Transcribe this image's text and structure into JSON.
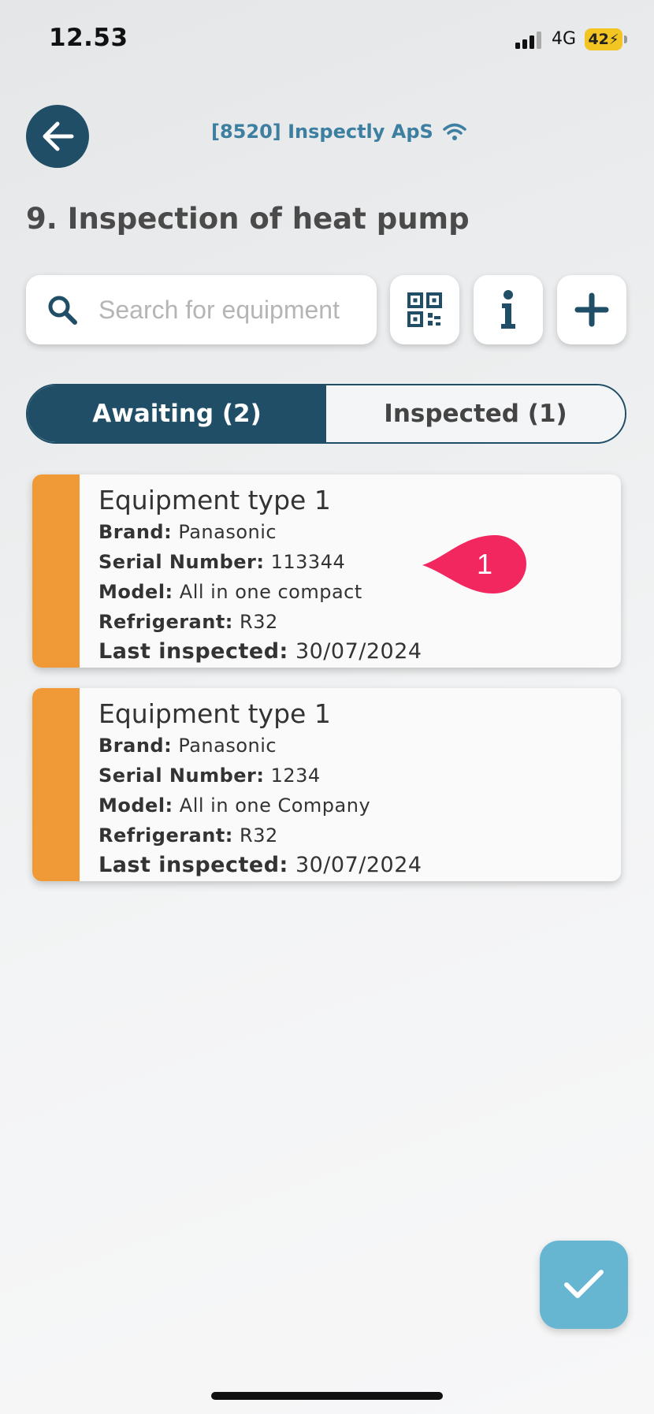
{
  "status_bar": {
    "time": "12.53",
    "network": "4G",
    "battery": "42"
  },
  "header": {
    "org_label": "[8520] Inspectly ApS",
    "title": "9. Inspection of heat pump"
  },
  "search": {
    "placeholder": "Search for equipment",
    "value": ""
  },
  "tabs": [
    {
      "label": "Awaiting (2)",
      "active": true
    },
    {
      "label": "Inspected (1)",
      "active": false
    }
  ],
  "equipment": [
    {
      "type": "Equipment type 1",
      "brand_label": "Brand:",
      "brand": "Panasonic",
      "serial_label": "Serial Number:",
      "serial": "113344",
      "model_label": "Model:",
      "model": "All in one compact",
      "refrigerant_label": "Refrigerant:",
      "refrigerant": "R32",
      "last_label": "Last inspected:",
      "last": "30/07/2024"
    },
    {
      "type": "Equipment type 1",
      "brand_label": "Brand:",
      "brand": "Panasonic",
      "serial_label": "Serial Number:",
      "serial": "1234",
      "model_label": "Model:",
      "model": "All in one Company",
      "refrigerant_label": "Refrigerant:",
      "refrigerant": "R32",
      "last_label": "Last inspected:",
      "last": "30/07/2024"
    }
  ],
  "annotation": {
    "number": "1"
  },
  "colors": {
    "primary": "#1f4e66",
    "accent_orange": "#ef9937",
    "fab": "#67b6d1",
    "marker": "#f2275f"
  },
  "icons": [
    "back-arrow-icon",
    "wifi-icon",
    "search-icon",
    "qr-code-icon",
    "info-icon",
    "plus-icon",
    "checkmark-icon"
  ]
}
